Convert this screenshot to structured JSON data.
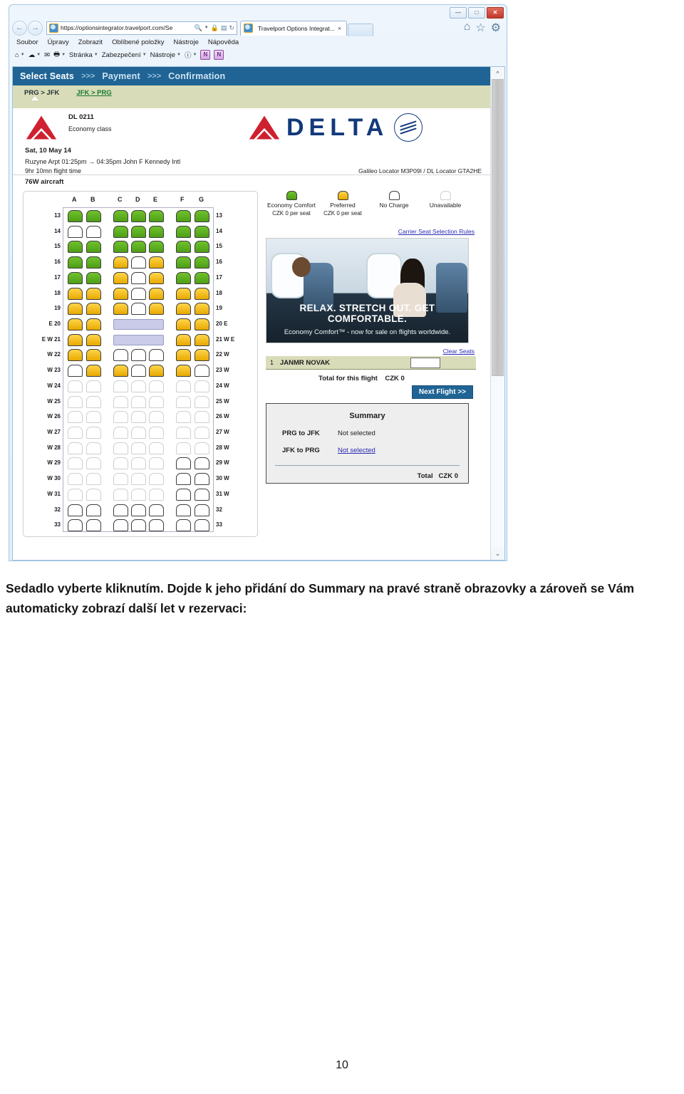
{
  "browser": {
    "window_controls": [
      "minimize",
      "maximize",
      "close"
    ],
    "back_icon": "back-arrow-icon",
    "forward_icon": "forward-arrow-icon",
    "url": "https://optionsintegrator.travelport.com/Se",
    "addr_icons": [
      "search-icon",
      "dropdown-caret",
      "lock-icon",
      "compat-view-icon",
      "refresh-icon"
    ],
    "tab_title": "Travelport Options Integrat...",
    "tab_close": "×",
    "nav_right_icons": [
      "home-icon",
      "favorites-star-icon",
      "tools-gear-icon"
    ],
    "menu_items": [
      "Soubor",
      "Úpravy",
      "Zobrazit",
      "Oblíbené položky",
      "Nástroje",
      "Nápověda"
    ],
    "command_bar": [
      {
        "type": "icon",
        "name": "home-icon",
        "caret": true
      },
      {
        "type": "icon",
        "name": "feeds-icon",
        "caret": true
      },
      {
        "type": "icon",
        "name": "mail-icon",
        "caret": false
      },
      {
        "type": "icon",
        "name": "print-icon",
        "caret": true
      },
      {
        "type": "text",
        "label": "Stránka",
        "caret": true
      },
      {
        "type": "text",
        "label": "Zabezpečení",
        "caret": true
      },
      {
        "type": "text",
        "label": "Nástroje",
        "caret": true
      },
      {
        "type": "icon",
        "name": "help-icon",
        "caret": true
      },
      {
        "type": "icon",
        "name": "onenote-send-icon",
        "caret": false
      },
      {
        "type": "icon",
        "name": "onenote-icon",
        "caret": false
      }
    ]
  },
  "app": {
    "steps": [
      {
        "label": "Select Seats",
        "active": true
      },
      {
        "label": ">>>",
        "sep": true
      },
      {
        "label": "Payment",
        "active": false
      },
      {
        "label": ">>>",
        "sep": true
      },
      {
        "label": "Confirmation",
        "active": false
      }
    ],
    "legs": [
      {
        "label": "PRG > JFK",
        "selected": true
      },
      {
        "label": "JFK > PRG",
        "selected": false
      }
    ],
    "flight": {
      "number": "DL  0211",
      "cabin_class": "Economy class",
      "airline_wordmark": "DELTA",
      "alliance": "SKYTEAM",
      "date": "Sat, 10 May 14",
      "route": "Ruzyne Arpt 01:25pm → 04:35pm John F Kennedy Intl",
      "duration": "9hr 10mn flight time",
      "locator": "Galileo Locator M3P09I / DL Locator GTA2HE",
      "aircraft": "76W aircraft"
    },
    "legend": [
      {
        "name": "Economy Comfort",
        "price": "CZK 0 per seat",
        "style": "green"
      },
      {
        "name": "Preferred",
        "price": "CZK 0 per seat",
        "style": "gold"
      },
      {
        "name": "No Charge",
        "price": "",
        "style": "free"
      },
      {
        "name": "Unavailable",
        "price": "",
        "style": "na"
      }
    ],
    "rules_link": "Carrier Seat Selection Rules",
    "ad": {
      "headline": "RELAX. STRETCH OUT. GET COMFORTABLE.",
      "subline": "Economy Comfort™ - now for sale on flights worldwide."
    },
    "clear_seats_link": "Clear Seats",
    "passenger": {
      "number": "1",
      "name": "JANMR NOVAK",
      "seat_value": ""
    },
    "flight_total_label": "Total for this flight",
    "flight_total_value": "CZK 0",
    "next_button": "Next Flight >>",
    "summary": {
      "title": "Summary",
      "rows": [
        {
          "label": "PRG to JFK",
          "value": "Not selected",
          "link": false
        },
        {
          "label": "JFK to PRG",
          "value": "Not selected",
          "link": true
        }
      ],
      "total_label": "Total",
      "total_value": "CZK 0"
    }
  },
  "seatmap": {
    "columns": [
      "A",
      "B",
      "C",
      "D",
      "E",
      "F",
      "G"
    ],
    "rows": [
      {
        "left": "13",
        "right": "13",
        "seats": [
          "green",
          "green",
          "green",
          "green",
          "green",
          "green",
          "green"
        ]
      },
      {
        "left": "14",
        "right": "14",
        "seats": [
          "free",
          "free",
          "green",
          "green",
          "green",
          "green",
          "green"
        ]
      },
      {
        "left": "15",
        "right": "15",
        "seats": [
          "green",
          "green",
          "green",
          "green",
          "green",
          "green",
          "green"
        ]
      },
      {
        "left": "16",
        "right": "16",
        "seats": [
          "green",
          "green",
          "gold",
          "free",
          "gold",
          "green",
          "green"
        ]
      },
      {
        "left": "17",
        "right": "17",
        "seats": [
          "green",
          "green",
          "gold",
          "free",
          "gold",
          "green",
          "green"
        ]
      },
      {
        "left": "18",
        "right": "18",
        "seats": [
          "gold",
          "gold",
          "gold",
          "free",
          "gold",
          "gold",
          "gold"
        ]
      },
      {
        "left": "19",
        "right": "19",
        "seats": [
          "gold",
          "gold",
          "gold",
          "free",
          "gold",
          "gold",
          "gold"
        ]
      },
      {
        "left": "E 20",
        "right": "20 E",
        "seats": [
          "gold",
          "gold",
          "exit",
          "exit",
          "exit",
          "gold",
          "gold"
        ]
      },
      {
        "left": "E W 21",
        "right": "21 W E",
        "seats": [
          "gold",
          "gold",
          "exit",
          "exit",
          "exit",
          "gold",
          "gold"
        ]
      },
      {
        "left": "W 22",
        "right": "22 W",
        "seats": [
          "gold",
          "gold",
          "free",
          "free",
          "free",
          "gold",
          "gold"
        ]
      },
      {
        "left": "W 23",
        "right": "23 W",
        "seats": [
          "free",
          "gold",
          "gold",
          "free",
          "gold",
          "gold",
          "free"
        ]
      },
      {
        "left": "W 24",
        "right": "24 W",
        "seats": [
          "na",
          "na",
          "na",
          "na",
          "na",
          "na",
          "na"
        ]
      },
      {
        "left": "W 25",
        "right": "25 W",
        "seats": [
          "na",
          "na",
          "na",
          "na",
          "na",
          "na",
          "na"
        ]
      },
      {
        "left": "W 26",
        "right": "26 W",
        "seats": [
          "na",
          "na",
          "na",
          "na",
          "na",
          "na",
          "na"
        ]
      },
      {
        "left": "W 27",
        "right": "27 W",
        "seats": [
          "na",
          "na",
          "na",
          "na",
          "na",
          "na",
          "na"
        ]
      },
      {
        "left": "W 28",
        "right": "28 W",
        "seats": [
          "na",
          "na",
          "na",
          "na",
          "na",
          "na",
          "na"
        ]
      },
      {
        "left": "W 29",
        "right": "29 W",
        "seats": [
          "na",
          "na",
          "na",
          "na",
          "na",
          "free",
          "free"
        ]
      },
      {
        "left": "W 30",
        "right": "30 W",
        "seats": [
          "na",
          "na",
          "na",
          "na",
          "na",
          "free",
          "free"
        ]
      },
      {
        "left": "W 31",
        "right": "31 W",
        "seats": [
          "na",
          "na",
          "na",
          "na",
          "na",
          "free",
          "free"
        ]
      },
      {
        "left": "32",
        "right": "32",
        "seats": [
          "free",
          "free",
          "free",
          "free",
          "free",
          "free",
          "free"
        ]
      },
      {
        "left": "33",
        "right": "33",
        "seats": [
          "free",
          "free",
          "free",
          "free",
          "free",
          "free",
          "free"
        ]
      }
    ]
  },
  "caption": "Sedadlo vyberte kliknutím. Dojde k jeho přidání do Summary na pravé straně obrazovky a zároveň se Vám automaticky zobrazí další let v rezervaci:",
  "page_number": "10"
}
